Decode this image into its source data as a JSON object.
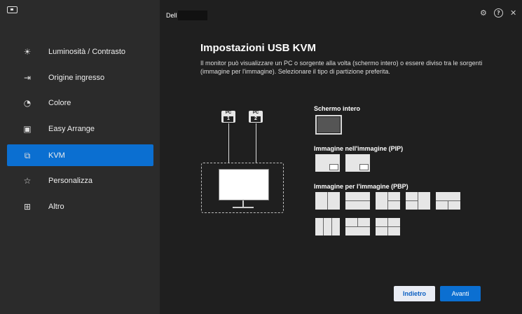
{
  "sidebar": {
    "items": [
      {
        "label": "Luminosità / Contrasto",
        "icon": "brightness-icon",
        "glyph": "☀"
      },
      {
        "label": "Origine ingresso",
        "icon": "input-source-icon",
        "glyph": "⇥"
      },
      {
        "label": "Colore",
        "icon": "color-icon",
        "glyph": "◔"
      },
      {
        "label": "Easy Arrange",
        "icon": "easy-arrange-icon",
        "glyph": "▣"
      },
      {
        "label": "KVM",
        "icon": "kvm-icon",
        "glyph": "⧉",
        "active": true
      },
      {
        "label": "Personalizza",
        "icon": "star-icon",
        "glyph": "☆"
      },
      {
        "label": "Altro",
        "icon": "other-icon",
        "glyph": "⊞"
      }
    ]
  },
  "header": {
    "monitor_name": "Dell",
    "icons": {
      "settings": "⚙",
      "help": "?",
      "close": "✕"
    }
  },
  "page": {
    "title": "Impostazioni USB KVM",
    "description": "Il monitor può visualizzare un PC o sorgente alla volta (schermo intero) o essere diviso tra le sorgenti (immagine per l'immagine). Selezionare il tipo di partizione preferita."
  },
  "diagram": {
    "pc1_label": "PC",
    "pc1_num": "1",
    "pc2_label": "PC",
    "pc2_num": "2"
  },
  "sections": {
    "fullscreen": "Schermo intero",
    "pip": "Immagine nell'immagine (PIP)",
    "pbp": "Immagine per l'immagine (PBP)"
  },
  "buttons": {
    "back": "Indietro",
    "next": "Avanti"
  },
  "colors": {
    "accent": "#0b6fd1",
    "sidebar_bg": "#2b2b2b",
    "main_bg": "#1f1f1f"
  }
}
